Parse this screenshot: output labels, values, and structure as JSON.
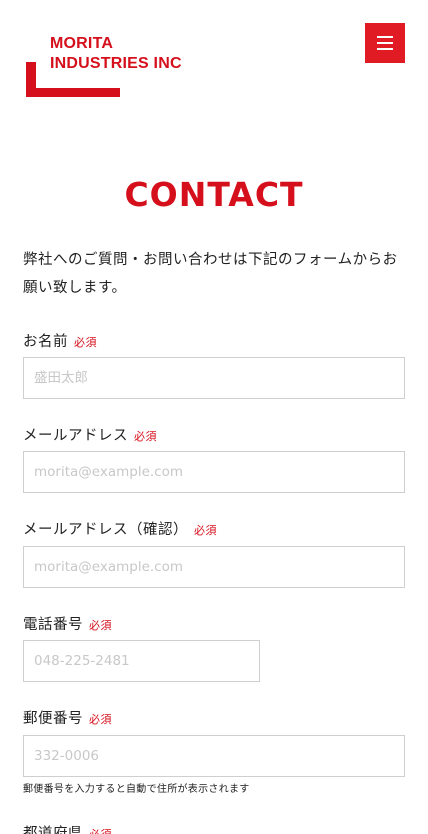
{
  "header": {
    "logo_line1": "MORITA",
    "logo_line2": "INDUSTRIES INC",
    "menu_icon": "hamburger-menu-icon",
    "accent_color": "#d5101c"
  },
  "page": {
    "title": "CONTACT",
    "intro": "弊社へのご質問・お問い合わせは下記のフォームからお願い致します。"
  },
  "form": {
    "required_badge": "必須",
    "name": {
      "label": "お名前",
      "placeholder": "盛田太郎"
    },
    "email": {
      "label": "メールアドレス",
      "placeholder": "morita@example.com"
    },
    "email_confirm": {
      "label": "メールアドレス（確認）",
      "placeholder": "morita@example.com"
    },
    "phone": {
      "label": "電話番号",
      "placeholder": "048-225-2481"
    },
    "zip": {
      "label": "郵便番号",
      "placeholder": "332-0006",
      "note": "郵便番号を入力すると自動で住所が表示されます"
    },
    "prefecture": {
      "label": "都道府県"
    }
  }
}
